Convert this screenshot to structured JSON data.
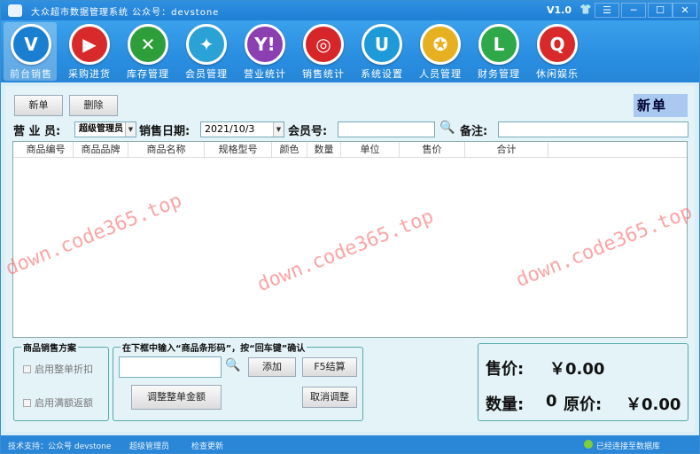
{
  "window": {
    "title": "大众超市数据管理系统  公众号：devstone",
    "version": "V1.0"
  },
  "toolbar": [
    {
      "label": "前台销售",
      "icon": "v-icon",
      "glyph": "V",
      "color": "#1a7fd0",
      "active": true
    },
    {
      "label": "采购进货",
      "icon": "play-icon",
      "glyph": "▶",
      "color": "#d82a2a"
    },
    {
      "label": "库存管理",
      "icon": "x-icon",
      "glyph": "✕",
      "color": "#2e9e3a"
    },
    {
      "label": "会员管理",
      "icon": "star-icon",
      "glyph": "✦",
      "color": "#2aa2d6"
    },
    {
      "label": "营业统计",
      "icon": "yahoo-icon",
      "glyph": "Y!",
      "color": "#8b3fb0"
    },
    {
      "label": "销售统计",
      "icon": "weibo-icon",
      "glyph": "◎",
      "color": "#d7262a"
    },
    {
      "label": "系统设置",
      "icon": "u-icon",
      "glyph": "U",
      "color": "#1e9ad8"
    },
    {
      "label": "人员管理",
      "icon": "share-icon",
      "glyph": "✪",
      "color": "#e6b020"
    },
    {
      "label": "财务管理",
      "icon": "finance-icon",
      "glyph": "L",
      "color": "#2fa84a"
    },
    {
      "label": "休闲娱乐",
      "icon": "q-icon",
      "glyph": "Q",
      "color": "#d82a2a"
    }
  ],
  "actions": {
    "new": "新单",
    "delete": "删除",
    "mode": "新单"
  },
  "form": {
    "staff_label": "营 业 员:",
    "staff_value": "超级管理员",
    "date_label": "销售日期:",
    "date_value": "2021/10/3",
    "member_label": "会员号:",
    "member_value": "",
    "remark_label": "备注:",
    "remark_value": ""
  },
  "grid": {
    "columns": [
      "商品编号",
      "商品品牌",
      "商品名称",
      "规格型号",
      "颜色",
      "数量",
      "单位",
      "售价",
      "合计"
    ],
    "rows": []
  },
  "promo": {
    "title": "商品销售方案",
    "option1": "启用整单折扣",
    "option2": "启用满额返额"
  },
  "barcode": {
    "title": "在下框中输入“商品条形码”，按“回车键”确认",
    "value": "",
    "add": "添加",
    "checkout": "F5结算",
    "adjust": "调整整单金额",
    "cancel_adjust": "取消调整"
  },
  "totals": {
    "price_label": "售价:",
    "price_value": "￥0.00",
    "qty_label": "数量:",
    "qty_value": "0",
    "orig_label": "原价:",
    "orig_value": "￥0.00"
  },
  "status": {
    "support": "技术支持：公众号 devstone",
    "user": "超级管理员",
    "update": "检查更新",
    "db": "已经连接至数据库"
  },
  "watermark": "down.code365.top"
}
